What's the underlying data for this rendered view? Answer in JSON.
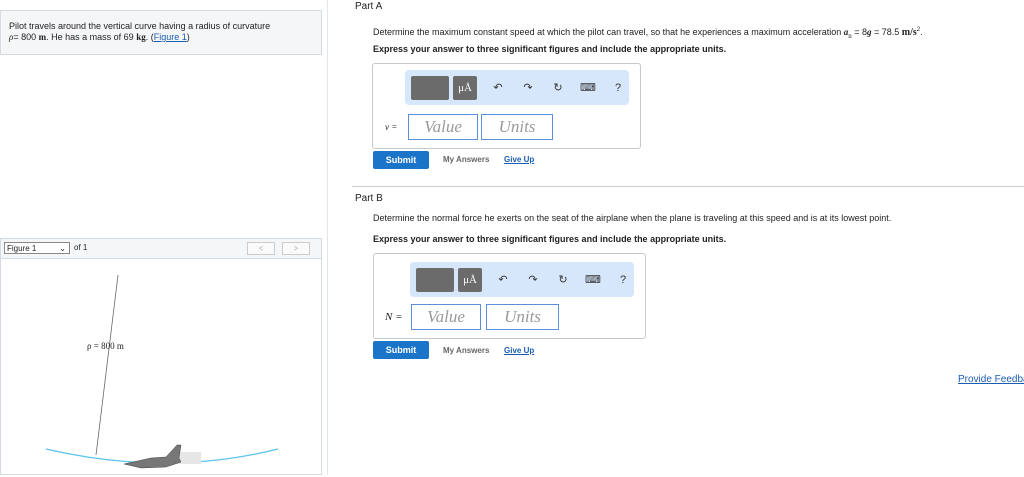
{
  "problem": {
    "text1": "Pilot travels around the vertical curve having a radius of curvature",
    "rho": "ρ",
    "eq": "= 800",
    "m": "m",
    "text2": ". He has a mass of 69",
    "kg": "kg",
    "paren_open": ". (",
    "figure_link": "Figure 1",
    "paren_close": ")"
  },
  "figure": {
    "select": "Figure 1",
    "of": "of 1",
    "prev": "<",
    "next": ">",
    "label": "ρ = 800 m"
  },
  "partA": {
    "title": "Part A",
    "question": "Determine the maximum constant speed at which the pilot can travel, so that he experiences a maximum acceleration",
    "accel": "a",
    "accel_sub": "n",
    "accel_eq": " = 8",
    "g": "g",
    "accel_val": " = 78.5 ",
    "unit": "m/s",
    "sup": "2",
    "end": ".",
    "instruction": "Express your answer to three significant figures and include the appropriate units.",
    "var": "v =",
    "value_placeholder": "Value",
    "units_placeholder": "Units",
    "submit": "Submit",
    "my_answers": "My Answers",
    "give_up": "Give Up"
  },
  "partB": {
    "title": "Part B",
    "question": "Determine the normal force he exerts on the seat of the airplane when the plane is traveling at this speed and is at its lowest point.",
    "instruction": "Express your answer to three significant figures and include the appropriate units.",
    "var": "N =",
    "value_placeholder": "Value",
    "units_placeholder": "Units",
    "submit": "Submit",
    "my_answers": "My Answers",
    "give_up": "Give Up"
  },
  "toolbar": {
    "mu": "μÅ",
    "undo": "↶",
    "redo": "↷",
    "reset": "↻",
    "keyboard": "⌨",
    "help": "?"
  },
  "feedback": "Provide Feedback"
}
